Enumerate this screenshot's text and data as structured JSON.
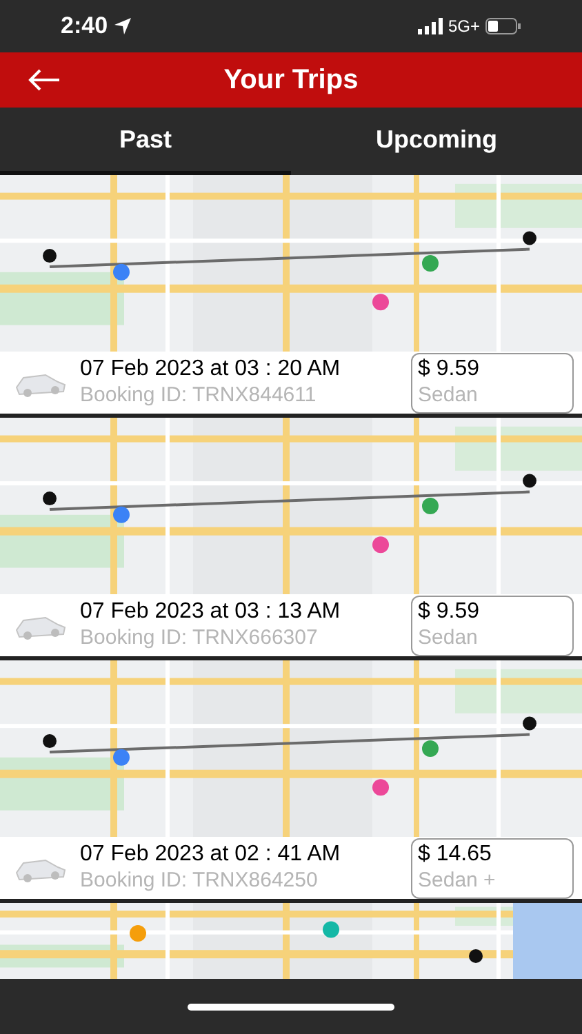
{
  "status_bar": {
    "time": "2:40",
    "network": "5G+"
  },
  "header": {
    "title": "Your Trips"
  },
  "tabs": [
    {
      "label": "Past",
      "selected": true
    },
    {
      "label": "Upcoming",
      "selected": false
    }
  ],
  "trips": [
    {
      "date": "07 Feb 2023 at 03 : 20 AM",
      "booking_id": "Booking ID: TRNX844611",
      "price": "$ 9.59",
      "car_type": "Sedan"
    },
    {
      "date": "07 Feb 2023 at 03 : 13 AM",
      "booking_id": "Booking ID: TRNX666307",
      "price": "$ 9.59",
      "car_type": "Sedan"
    },
    {
      "date": "07 Feb 2023 at 02 : 41 AM",
      "booking_id": "Booking ID: TRNX864250",
      "price": "$ 14.65",
      "car_type": "Sedan +"
    }
  ]
}
